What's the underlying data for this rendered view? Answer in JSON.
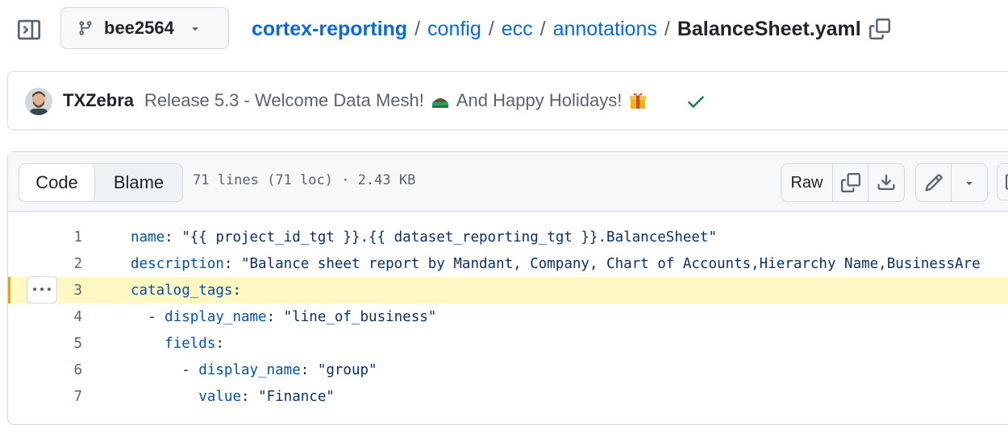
{
  "branch": {
    "name": "bee2564"
  },
  "breadcrumb": {
    "repo": "cortex-reporting",
    "segments": [
      "config",
      "ecc",
      "annotations"
    ],
    "file": "BalanceSheet.yaml",
    "separator": "/"
  },
  "commit": {
    "author": "TXZebra",
    "message_part1": "Release 5.3 - Welcome Data Mesh!",
    "message_part2": "And Happy Holidays!",
    "status": "success"
  },
  "file_view": {
    "tabs": [
      "Code",
      "Blame"
    ],
    "active_tab": "Code",
    "meta": "71 lines (71 loc) · 2.43 KB",
    "raw_label": "Raw"
  },
  "code": {
    "highlighted_line": 3,
    "lines": [
      {
        "n": "1",
        "indent": "",
        "dash": "",
        "key": "name",
        "colon": ": ",
        "value": "\"{{ project_id_tgt }}.{{ dataset_reporting_tgt }}.BalanceSheet\""
      },
      {
        "n": "2",
        "indent": "",
        "dash": "",
        "key": "description",
        "colon": ": ",
        "value": "\"Balance sheet report by Mandant, Company, Chart of Accounts,Hierarchy Name,BusinessAre"
      },
      {
        "n": "3",
        "indent": "",
        "dash": "",
        "key": "catalog_tags",
        "colon": ":",
        "value": ""
      },
      {
        "n": "4",
        "indent": "  ",
        "dash": "- ",
        "key": "display_name",
        "colon": ": ",
        "value": "\"line_of_business\""
      },
      {
        "n": "5",
        "indent": "    ",
        "dash": "",
        "key": "fields",
        "colon": ":",
        "value": ""
      },
      {
        "n": "6",
        "indent": "      ",
        "dash": "- ",
        "key": "display_name",
        "colon": ": ",
        "value": "\"group\""
      },
      {
        "n": "7",
        "indent": "        ",
        "dash": "",
        "key": "value",
        "colon": ": ",
        "value": "\"Finance\""
      }
    ]
  },
  "icons": {
    "sidebar": "sidebar-expand-icon",
    "branch": "git-branch-icon",
    "copy": "copy-icon",
    "download": "download-icon",
    "edit": "pencil-icon",
    "check": "check-icon",
    "kebab": "kebab-horizontal-icon"
  },
  "colors": {
    "link": "#0969da",
    "success": "#1a7f37",
    "highlight": "#fff8c5",
    "yaml_key": "#0550ae",
    "yaml_string": "#0a3069"
  }
}
